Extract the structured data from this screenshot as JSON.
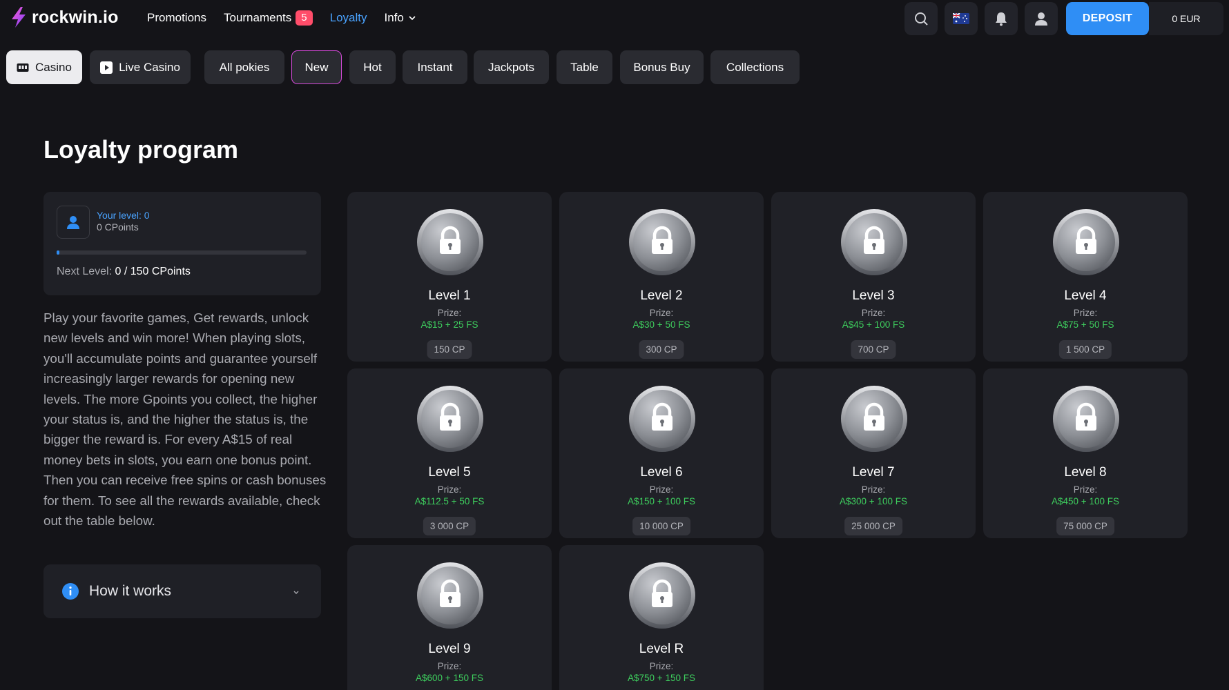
{
  "header": {
    "logo_text": "rockwin.io",
    "nav": [
      {
        "label": "Promotions"
      },
      {
        "label": "Tournaments",
        "badge": "5"
      },
      {
        "label": "Loyalty",
        "active": true
      },
      {
        "label": "Info"
      }
    ],
    "deposit_label": "DEPOSIT",
    "balance": "0 EUR",
    "icons": [
      "search-icon",
      "au-flag-icon",
      "bell-icon",
      "user-icon"
    ]
  },
  "categories": [
    {
      "label": "Casino",
      "icon": "casino-icon"
    },
    {
      "label": "Live Casino",
      "icon": "play-icon"
    },
    {
      "label": "All pokies"
    },
    {
      "label": "New"
    },
    {
      "label": "Hot"
    },
    {
      "label": "Instant"
    },
    {
      "label": "Jackpots"
    },
    {
      "label": "Table"
    },
    {
      "label": "Bonus Buy"
    },
    {
      "label": "Collections"
    }
  ],
  "page": {
    "title": "Loyalty program",
    "your_level": "Your level: 0",
    "cpoints": "0 CPoints",
    "progress_fraction": 0,
    "next_level_label": "Next Level:",
    "next_level_value": "0 / 150 CPoints",
    "description": "Play your favorite games, Get rewards, unlock new levels and win more! When playing slots, you'll accumulate points and guarantee yourself increasingly larger rewards for opening new levels. The more Gpoints you collect, the higher your status is, and the higher the status is, the bigger the reward is. For every A$15 of real money bets in slots, you earn one bonus point. Then you can receive free spins or cash bonuses for them. To see all the rewards available, check out the table below.",
    "how_it_works": "How it works"
  },
  "prize_label": "Prize:",
  "levels": [
    {
      "name": "Level 1",
      "prize": "A$15 + 25 FS",
      "cp": "150 CP"
    },
    {
      "name": "Level 2",
      "prize": "A$30 + 50 FS",
      "cp": "300 CP"
    },
    {
      "name": "Level 3",
      "prize": "A$45 + 100 FS",
      "cp": "700 CP"
    },
    {
      "name": "Level 4",
      "prize": "A$75 + 50 FS",
      "cp": "1 500 CP"
    },
    {
      "name": "Level 5",
      "prize": "A$112.5 + 50 FS",
      "cp": "3 000 CP"
    },
    {
      "name": "Level 6",
      "prize": "A$150 + 100 FS",
      "cp": "10 000 CP"
    },
    {
      "name": "Level 7",
      "prize": "A$300 + 100 FS",
      "cp": "25 000 CP"
    },
    {
      "name": "Level 8",
      "prize": "A$450 + 100 FS",
      "cp": "75 000 CP"
    },
    {
      "name": "Level 9",
      "prize": "A$600 + 150 FS",
      "cp": ""
    },
    {
      "name": "Level R",
      "prize": "A$750 + 150 FS",
      "cp": ""
    }
  ],
  "colors": {
    "accent": "#2f8ef5",
    "link_active": "#4aa3ff",
    "prize_green": "#3ecf5e",
    "badge": "#ff4d6a",
    "selected_outline": "#d64bdb"
  }
}
